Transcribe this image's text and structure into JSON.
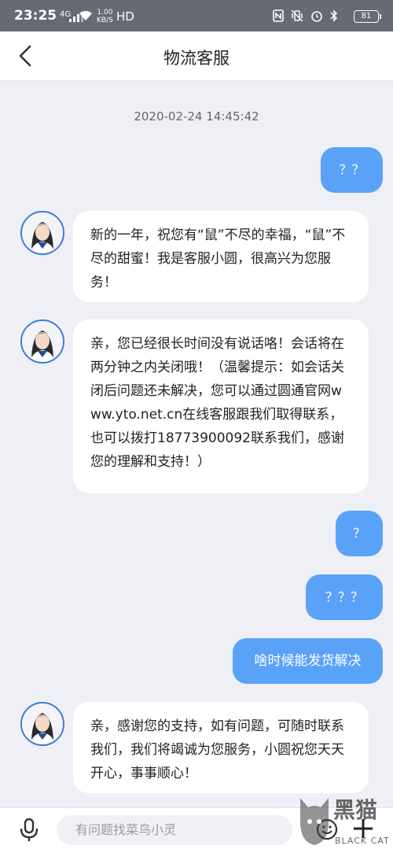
{
  "status_bar": {
    "time": "23:25",
    "network": "4G",
    "speed_value": "1.00",
    "speed_unit": "KB/S",
    "hd": "HD",
    "battery": "81"
  },
  "header": {
    "title": "物流客服"
  },
  "chat": {
    "timestamp": "2020-02-24 14:45:42",
    "messages": [
      {
        "side": "user",
        "text": "？？"
      },
      {
        "side": "agent",
        "text": "新的一年，祝您有“鼠”不尽的幸福，“鼠”不尽的甜蜜！我是客服小圆，很高兴为您服务！"
      },
      {
        "side": "agent",
        "text": "亲，您已经很长时间没有说话咯！会话将在两分钟之内关闭哦！（温馨提示：如会话关闭后问题还未解决，您可以通过圆通官网www.yto.net.cn在线客服跟我们取得联系，也可以拨打18773900092联系我们，感谢您的理解和支持！）"
      },
      {
        "side": "user",
        "text": "？"
      },
      {
        "side": "user",
        "text": "？？？"
      },
      {
        "side": "user",
        "text": "啥时候能发货解决"
      },
      {
        "side": "agent",
        "text": "亲，感谢您的支持，如有问题，可随时联系我们，我们将竭诚为您服务，小圆祝您天天开心，事事顺心！"
      }
    ]
  },
  "input_bar": {
    "placeholder": "有问题找菜鸟小灵"
  },
  "watermark": {
    "text": "黑猫",
    "subtext": "BLACK CAT"
  },
  "colors": {
    "user_bubble": "#5aa2f8",
    "background": "#eef0f6",
    "avatar_ring": "#3c7ad8"
  }
}
